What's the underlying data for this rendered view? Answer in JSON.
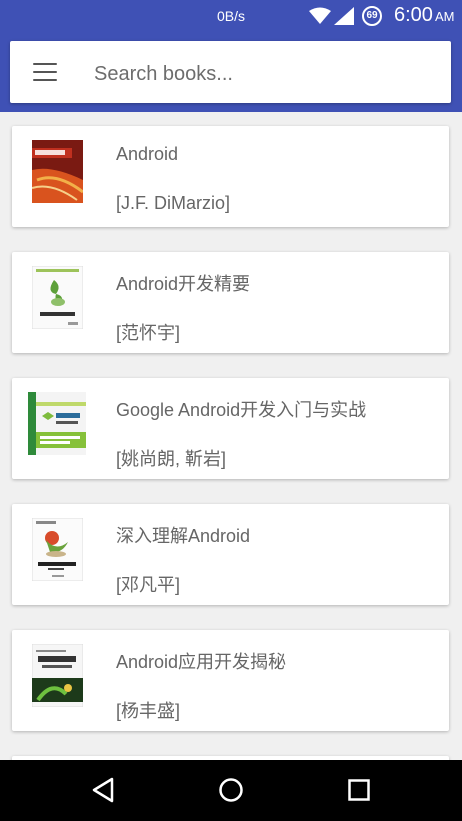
{
  "status_bar": {
    "net_speed": "0B/s",
    "battery_level": "69",
    "time": "6:00",
    "ampm": "AM",
    "bg_color": "#3f51b5"
  },
  "search": {
    "placeholder": "Search books..."
  },
  "books": [
    {
      "title": "Android",
      "author": "[J.F. DiMarzio]"
    },
    {
      "title": "Android开发精要",
      "author": "[范怀宇]"
    },
    {
      "title": "Google Android开发入门与实战",
      "author": "[姚尚朗, 靳岩]"
    },
    {
      "title": "深入理解Android",
      "author": "[邓凡平]"
    },
    {
      "title": "Android应用开发揭秘",
      "author": "[杨丰盛]"
    }
  ],
  "icons": {
    "menu": "menu-icon",
    "back": "back-icon",
    "home": "home-icon",
    "recents": "recents-icon"
  }
}
